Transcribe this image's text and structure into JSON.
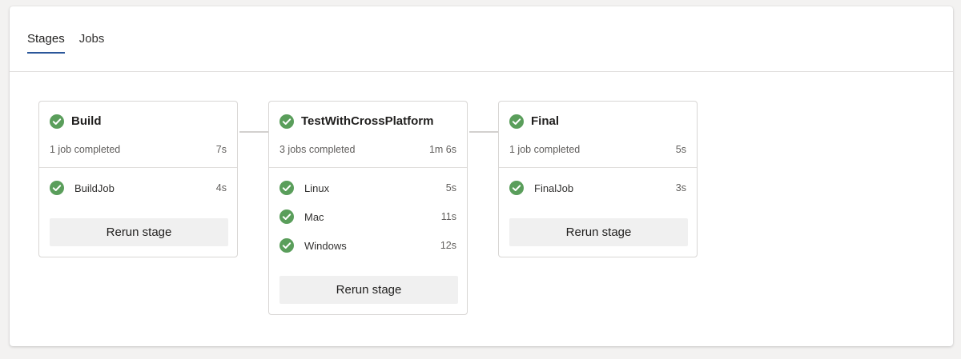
{
  "tabs": [
    {
      "label": "Stages",
      "active": true
    },
    {
      "label": "Jobs",
      "active": false
    }
  ],
  "colors": {
    "success": "#5a9e5b",
    "tab_underline": "#2b579a"
  },
  "stages": [
    {
      "name": "Build",
      "status": "succeeded",
      "summary": "1 job completed",
      "duration": "7s",
      "jobs": [
        {
          "name": "BuildJob",
          "duration": "4s",
          "status": "succeeded"
        }
      ],
      "rerun_label": "Rerun stage"
    },
    {
      "name": "TestWithCrossPlatform",
      "status": "succeeded",
      "summary": "3 jobs completed",
      "duration": "1m 6s",
      "jobs": [
        {
          "name": "Linux",
          "duration": "5s",
          "status": "succeeded"
        },
        {
          "name": "Mac",
          "duration": "11s",
          "status": "succeeded"
        },
        {
          "name": "Windows",
          "duration": "12s",
          "status": "succeeded"
        }
      ],
      "rerun_label": "Rerun stage"
    },
    {
      "name": "Final",
      "status": "succeeded",
      "summary": "1 job completed",
      "duration": "5s",
      "jobs": [
        {
          "name": "FinalJob",
          "duration": "3s",
          "status": "succeeded"
        }
      ],
      "rerun_label": "Rerun stage"
    }
  ]
}
